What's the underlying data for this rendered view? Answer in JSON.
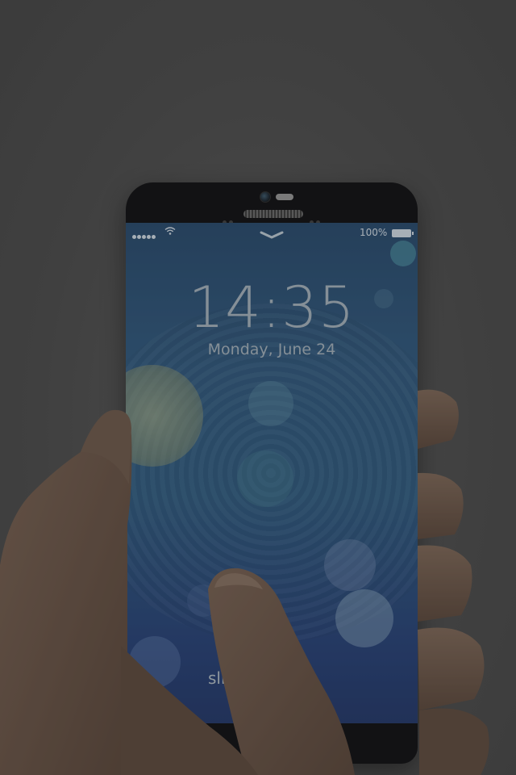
{
  "lockscreen": {
    "time": "14:35",
    "date": "Monday, June 24",
    "battery_percent": "100%",
    "slide_text": "slide",
    "signal_dots": 5
  },
  "colors": {
    "background": "#4c4c4c",
    "screen_top": "#25496e",
    "screen_bottom": "#1f356a",
    "phone_body": "#0b0b0d",
    "skin": "#6b5446"
  },
  "icons": [
    "wifi-icon",
    "battery-icon",
    "chevron-down-icon",
    "home-button-icon",
    "camera-icon",
    "speaker-icon"
  ]
}
